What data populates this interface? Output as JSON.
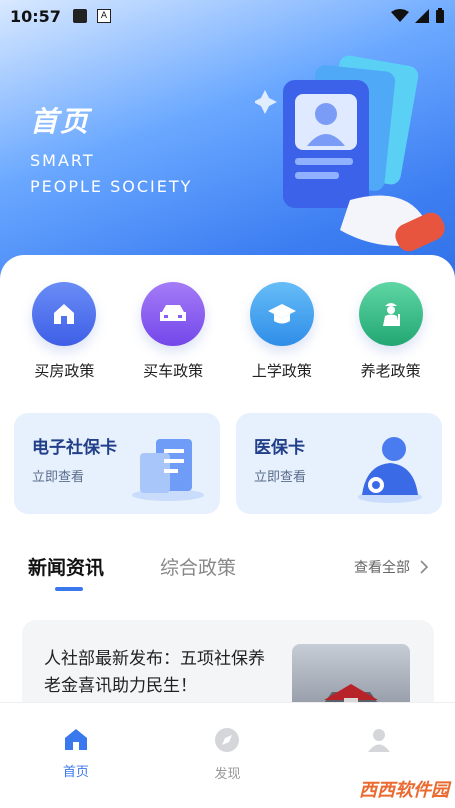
{
  "status": {
    "time": "10:57",
    "notif_icon": "A"
  },
  "hero": {
    "title": "首页",
    "subtitle_line1": "SMART",
    "subtitle_line2": "PEOPLE SOCIETY"
  },
  "grid": [
    {
      "label": "买房政策",
      "icon": "house-icon",
      "color": "#4f73f0"
    },
    {
      "label": "买车政策",
      "icon": "car-icon",
      "color": "#8a5cf3"
    },
    {
      "label": "上学政策",
      "icon": "graduation-cap-icon",
      "color": "#3ea2f2"
    },
    {
      "label": "养老政策",
      "icon": "elderly-icon",
      "color": "#35c08a"
    }
  ],
  "tiles": [
    {
      "title": "电子社保卡",
      "sub": "立即查看"
    },
    {
      "title": "医保卡",
      "sub": "立即查看"
    }
  ],
  "tabs": {
    "active": "新闻资讯",
    "other": "综合政策",
    "more": "查看全部"
  },
  "news": {
    "title": "人社部最新发布：五项社保养老金喜讯助力民生！"
  },
  "nav": [
    {
      "label": "首页",
      "active": true
    },
    {
      "label": "发现",
      "active": false
    },
    {
      "label": "",
      "active": false
    }
  ],
  "watermark": "西西软件园"
}
